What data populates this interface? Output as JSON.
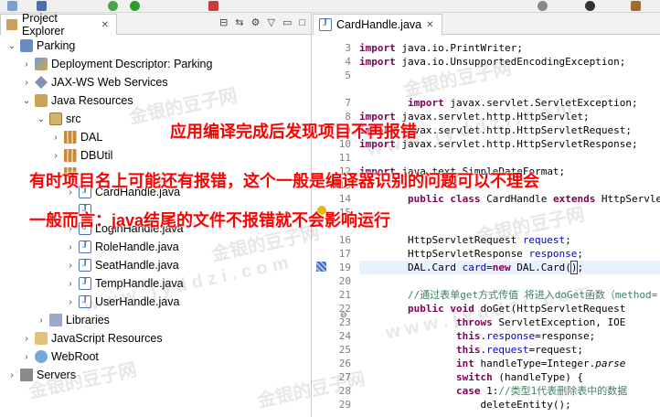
{
  "explorer": {
    "title": "Project Explorer",
    "tree": [
      {
        "label": "Parking",
        "icon": "project-icon",
        "arrow": "⌄",
        "level": 0
      },
      {
        "label": "Deployment Descriptor: Parking",
        "icon": "deployment-descriptor-icon",
        "arrow": "›",
        "level": 1
      },
      {
        "label": "JAX-WS Web Services",
        "icon": "web-services-icon",
        "arrow": "›",
        "level": 1
      },
      {
        "label": "Java Resources",
        "icon": "java-resources-icon",
        "arrow": "⌄",
        "level": 1
      },
      {
        "label": "src",
        "icon": "source-folder-icon",
        "arrow": "⌄",
        "level": 2
      },
      {
        "label": "DAL",
        "icon": "package-icon",
        "arrow": "›",
        "level": 3
      },
      {
        "label": "DBUtil",
        "icon": "package-icon",
        "arrow": "›",
        "level": 3
      },
      {
        "label": "",
        "icon": "package-icon",
        "arrow": "",
        "level": 3
      },
      {
        "label": "CardHandle.java",
        "icon": "java-file-icon",
        "arrow": "›",
        "level": 4
      },
      {
        "label": "",
        "icon": "java-file-icon",
        "arrow": "",
        "level": 4
      },
      {
        "label": "LoginHandle.java",
        "icon": "java-file-icon",
        "arrow": "›",
        "level": 4
      },
      {
        "label": "RoleHandle.java",
        "icon": "java-file-icon",
        "arrow": "›",
        "level": 4
      },
      {
        "label": "SeatHandle.java",
        "icon": "java-file-icon",
        "arrow": "›",
        "level": 4
      },
      {
        "label": "TempHandle.java",
        "icon": "java-file-icon",
        "arrow": "›",
        "level": 4
      },
      {
        "label": "UserHandle.java",
        "icon": "java-file-icon",
        "arrow": "›",
        "level": 4
      },
      {
        "label": "Libraries",
        "icon": "libraries-icon",
        "arrow": "›",
        "level": 2
      },
      {
        "label": "JavaScript Resources",
        "icon": "javascript-resources-icon",
        "arrow": "›",
        "level": 1
      },
      {
        "label": "WebRoot",
        "icon": "webroot-icon",
        "arrow": "›",
        "level": 1
      },
      {
        "label": "Servers",
        "icon": "servers-icon",
        "arrow": "›",
        "level": 0
      }
    ]
  },
  "editor": {
    "tab": "CardHandle.java",
    "lines": [
      {
        "n": "3",
        "t": "<span class='kw'>import</span> java.io.PrintWriter;"
      },
      {
        "n": "4",
        "t": "<span class='kw'>import</span> java.io.UnsupportedEncodingException;"
      },
      {
        "n": "5",
        "t": ""
      },
      {
        "n": "7",
        "t": "        <span class='kw'>import</span> javax.servlet.ServletException;"
      },
      {
        "n": "8",
        "t": "<span class='kw'>import</span> javax.servlet.http.HttpServlet;"
      },
      {
        "n": "9",
        "t": "<span class='kw'>import</span> javax.servlet.http.HttpServletRequest;"
      },
      {
        "n": "10",
        "t": "<span class='kw'>import</span> javax.servlet.http.HttpServletResponse;"
      },
      {
        "n": "11",
        "t": ""
      },
      {
        "n": "12",
        "t": "<span class='kw'>import</span> java.text.SimpleDateFormat;"
      },
      {
        "n": "13",
        "t": ""
      },
      {
        "n": "14",
        "t": "        <span class='kw'>public class</span> CardHandle <span class='kw'>extends</span> HttpServlet"
      },
      {
        "n": "15",
        "t": ""
      },
      {
        "n": "16",
        "t": "        HttpServletRequest <span class='fld'>request</span>;"
      },
      {
        "n": "17",
        "t": "        HttpServletResponse <span class='fld'>response</span>;"
      },
      {
        "n": "19",
        "t": "        DAL.Card <span class='fld'>card</span>=<span class='kw'>new</span> DAL.Card(<span style='outline:1px solid #444'>)</span>;"
      },
      {
        "n": "20",
        "t": ""
      },
      {
        "n": "21",
        "t": "        <span class='cm'>//通过表单get方式传值 将进入doGet函数（method=</span>"
      },
      {
        "n": "22",
        "t": "        <span class='kw'>public void</span> doGet(HttpServletRequest"
      },
      {
        "n": "23",
        "t": "                <span class='kw'>throws</span> ServletException, IOE"
      },
      {
        "n": "24",
        "t": "                <span class='kw'>this</span>.<span class='fld'>response</span>=response;"
      },
      {
        "n": "25",
        "t": "                <span class='kw'>this</span>.<span class='fld'>request</span>=request;"
      },
      {
        "n": "26",
        "t": "                <span class='kw'>int</span> handleType=Integer.<span class='it'>parse</span>"
      },
      {
        "n": "27",
        "t": "                <span class='kw'>switch</span> (handleType) {"
      },
      {
        "n": "28",
        "t": "                <span class='kw'>case</span> 1:<span class='cm'>//类型1代表删除表中的数据</span>"
      },
      {
        "n": "29",
        "t": "                    deleteEntity();"
      }
    ]
  },
  "annotations": {
    "line1": "应用编译完成后发现项目不再报错",
    "line2": "有时项目名上可能还有报错，这个一般是编译器识别的问题可以不理会",
    "line3": "一般而言：java结尾的文件不报错就不会影响运行"
  },
  "watermarks": [
    "金银的豆子网",
    "w w w . j y d d z i . c o m"
  ],
  "colors": {
    "annotation": "#ff0000",
    "keyword": "#7f0055",
    "comment": "#3f7f5f",
    "field": "#0000c0"
  }
}
